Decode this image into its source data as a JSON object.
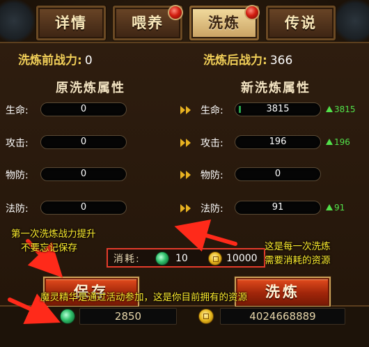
{
  "tabs": [
    {
      "label": "详情",
      "badge": false
    },
    {
      "label": "喂养",
      "badge": true
    },
    {
      "label": "洗炼",
      "badge": true
    },
    {
      "label": "传说",
      "badge": false
    }
  ],
  "active_tab": "洗炼",
  "power": {
    "before_label": "洗炼前战力:",
    "before_value": "0",
    "after_label": "洗炼后战力:",
    "after_value": "366"
  },
  "headers": {
    "original": "原洗炼属性",
    "new": "新洗炼属性"
  },
  "attributes": [
    {
      "label": "生命:",
      "original": "0",
      "new": "3815",
      "gain": "3815"
    },
    {
      "label": "攻击:",
      "original": "0",
      "new": "196",
      "gain": "196"
    },
    {
      "label": "物防:",
      "original": "0",
      "new": "0",
      "gain": ""
    },
    {
      "label": "法防:",
      "original": "0",
      "new": "91",
      "gain": "91"
    }
  ],
  "consume": {
    "label": "消耗:",
    "gem_cost": "10",
    "coin_cost": "10000"
  },
  "buttons": {
    "save": "保存",
    "refine": "洗炼"
  },
  "resources": {
    "gem_amount": "2850",
    "coin_amount": "4024668889"
  },
  "annotations": {
    "first_refine": [
      "第一次洗炼战力提升",
      "不要忘记保存"
    ],
    "each_refine": [
      "这是每一次洗炼",
      "需要消耗的资源"
    ],
    "resource_note": "魔灵精华是通过活动参加，这是你目前拥有的资源"
  },
  "colors": {
    "annotation_text": "#ffee2e",
    "annotation_arrow": "#ff2a1a",
    "gain_green": "#52e04a",
    "power_gold": "#f1cf58",
    "highlight_box": "#e53c2b"
  },
  "icons": [
    "gem-icon",
    "coin-icon",
    "arrow-right-icon",
    "up-arrow-icon",
    "notification-dot-icon"
  ]
}
